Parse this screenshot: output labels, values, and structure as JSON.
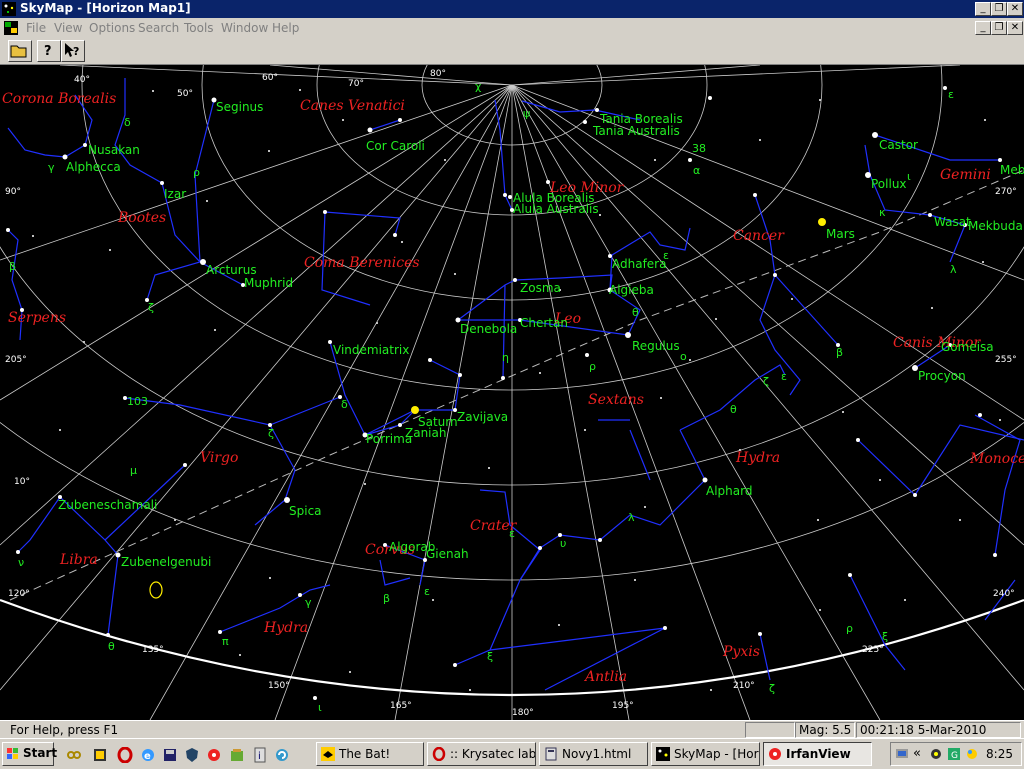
{
  "window": {
    "title": "SkyMap - [Horizon Map1]",
    "min_glyph": "_",
    "restore_glyph": "❐",
    "close_glyph": "✕"
  },
  "menu": {
    "items": [
      "File",
      "View",
      "Options",
      "Search",
      "Tools",
      "Window",
      "Help"
    ]
  },
  "toolbar": {
    "buttons": [
      {
        "name": "open-folder-icon"
      },
      {
        "name": "help-icon",
        "glyph": "?"
      },
      {
        "name": "context-help-icon",
        "glyph": "?"
      }
    ]
  },
  "map": {
    "gridlabels": [
      "40°",
      "50°",
      "60°",
      "70°",
      "80°",
      "90°",
      "205°",
      "10°",
      "120°",
      "135°",
      "150°",
      "165°",
      "180°",
      "195°",
      "210°",
      "225°",
      "240°",
      "255°",
      "270°"
    ],
    "constellations": [
      "Corona Borealis",
      "Canes Venatici",
      "Bootes",
      "Coma Berenices",
      "Serpens",
      "Leo Minor",
      "Cancer",
      "Gemini",
      "Leo",
      "Canis Minor",
      "Sextans",
      "Virgo",
      "Hydra",
      "Monoceros",
      "Crater",
      "Corvus",
      "Libra",
      "Hydra",
      "Antlia",
      "Pyxis"
    ],
    "stars": [
      "Seginus",
      "Nusakan",
      "Alphecca",
      "Izar",
      "Cor Caroli",
      "Arcturus",
      "Muphrid",
      "Tania Borealis",
      "Tania Australis",
      "Alula Borealis",
      "Alula Australis",
      "Castor",
      "Pollux",
      "Wasat",
      "Mekbuda",
      "Meb",
      "Adhafera",
      "Zosma",
      "Algieba",
      "Denebola",
      "Chertan",
      "Regulus",
      "Vindemiatrix",
      "Gomeisa",
      "Procyon",
      "Zavijava",
      "Porrima",
      "Zaniah",
      "Alphard",
      "Spica",
      "Zubeneschamali",
      "Zubenelgenubi",
      "Algorab",
      "Gienah"
    ],
    "planets": [
      "Mars",
      "Saturn"
    ],
    "greek": [
      "χ",
      "ψ",
      "δ",
      "γ",
      "ρ",
      "β",
      "ζ",
      "38",
      "α",
      "ε",
      "ι",
      "κ",
      "λ",
      "θ",
      "υ",
      "ε",
      "ζ",
      "ε",
      "ρ",
      "θ",
      "β",
      "ο",
      "103",
      "δ",
      "ζ",
      "μ",
      "ν",
      "ε",
      "β",
      "γ",
      "λ",
      "θ",
      "π",
      "ξ",
      "ρ",
      "ξ",
      "ζ",
      "ε",
      "ι",
      "η"
    ]
  },
  "status": {
    "help": "For Help, press F1",
    "panel1": "",
    "mag": "Mag: 5.5",
    "datetime": "00:21:18 5-Mar-2010"
  },
  "taskbar": {
    "start": "Start",
    "tasks": [
      "The Bat!",
      ":: Krysatec labs...",
      "Novy1.html",
      "SkyMap - [Hori...",
      "IrfanView"
    ],
    "clock": "8:25",
    "tray_chevron": "«"
  },
  "colors": {
    "titlebar": "#0a246a",
    "chrome": "#d4d0c8",
    "star_label": "#22ee22",
    "constellation_label": "#ee2222",
    "constellation_line": "#2030ff",
    "grid": "#cccccc"
  }
}
